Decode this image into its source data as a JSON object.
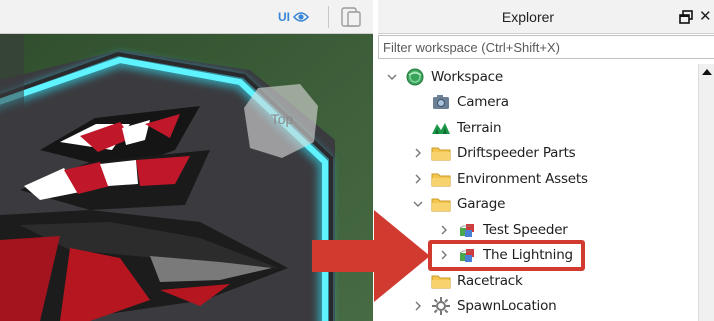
{
  "viewport": {
    "ui_toggle_label": "UI",
    "view_cube_face": "Top",
    "icons": {
      "ui_toggle": "eye-icon",
      "device": "device-emulator-icon"
    }
  },
  "explorer": {
    "title": "Explorer",
    "filter_placeholder": "Filter workspace (Ctrl+Shift+X)",
    "tree": [
      {
        "label": "Workspace",
        "depth": 0,
        "expander": "expanded",
        "icon": "workspace-globe-icon"
      },
      {
        "label": "Camera",
        "depth": 1,
        "expander": "none",
        "icon": "camera-icon"
      },
      {
        "label": "Terrain",
        "depth": 1,
        "expander": "none",
        "icon": "terrain-icon"
      },
      {
        "label": "Driftspeeder Parts",
        "depth": 1,
        "expander": "collapsed",
        "icon": "folder-icon"
      },
      {
        "label": "Environment Assets",
        "depth": 1,
        "expander": "collapsed",
        "icon": "folder-icon"
      },
      {
        "label": "Garage",
        "depth": 1,
        "expander": "expanded",
        "icon": "folder-icon"
      },
      {
        "label": "Test Speeder",
        "depth": 2,
        "expander": "collapsed",
        "icon": "model-icon"
      },
      {
        "label": "The Lightning",
        "depth": 2,
        "expander": "collapsed",
        "icon": "model-icon",
        "highlighted": true
      },
      {
        "label": "Racetrack",
        "depth": 1,
        "expander": "none",
        "icon": "folder-icon"
      },
      {
        "label": "SpawnLocation",
        "depth": 1,
        "expander": "collapsed",
        "icon": "spawn-location-icon"
      }
    ]
  },
  "colors": {
    "highlight": "#d03a2f",
    "arrow": "#d03a2f",
    "neon": "#2fe8ff",
    "ui_toggle": "#3a86d8",
    "folder": "#f4c650"
  }
}
